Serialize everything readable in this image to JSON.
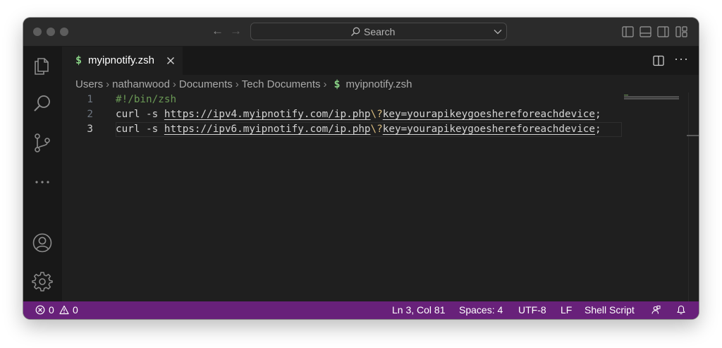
{
  "window": {
    "search": {
      "label": "Search"
    }
  },
  "tabs": [
    {
      "icon": "$",
      "title": "myipnotify.zsh",
      "active": true
    }
  ],
  "breadcrumbs": {
    "items": [
      "Users",
      "nathanwood",
      "Documents",
      "Tech Documents"
    ],
    "file_icon": "$",
    "file": "myipnotify.zsh"
  },
  "editor": {
    "lines": [
      {
        "number": "1",
        "shebang": "#!/bin/zsh"
      },
      {
        "number": "2",
        "cmd": "curl -s ",
        "url_a": "https://ipv4.myipnotify.com/ip.php",
        "esc": "\\?",
        "url_b": "key=yourapikeygoeshereforeachdevice",
        "tail": ";"
      },
      {
        "number": "3",
        "cmd": "curl -s ",
        "url_a": "https://ipv6.myipnotify.com/ip.php",
        "esc": "\\?",
        "url_b": "key=yourapikeygoeshereforeachdevice",
        "tail": ";"
      }
    ],
    "current_line": 3
  },
  "statusbar": {
    "errors": "0",
    "warnings": "0",
    "position": "Ln 3, Col 81",
    "spaces": "Spaces: 4",
    "encoding": "UTF-8",
    "eol": "LF",
    "language": "Shell Script"
  },
  "colors": {
    "statusbar_bg": "#68217a",
    "editor_bg": "#1f1f1f",
    "shell_icon": "#89d185",
    "comment": "#6a9955"
  },
  "icons": [
    "explorer-icon",
    "search-icon",
    "source-control-icon",
    "ellipsis-icon",
    "account-icon",
    "gear-icon",
    "close-icon",
    "split-editor-icon",
    "bell-icon",
    "feedback-icon",
    "error-icon",
    "warning-icon"
  ]
}
